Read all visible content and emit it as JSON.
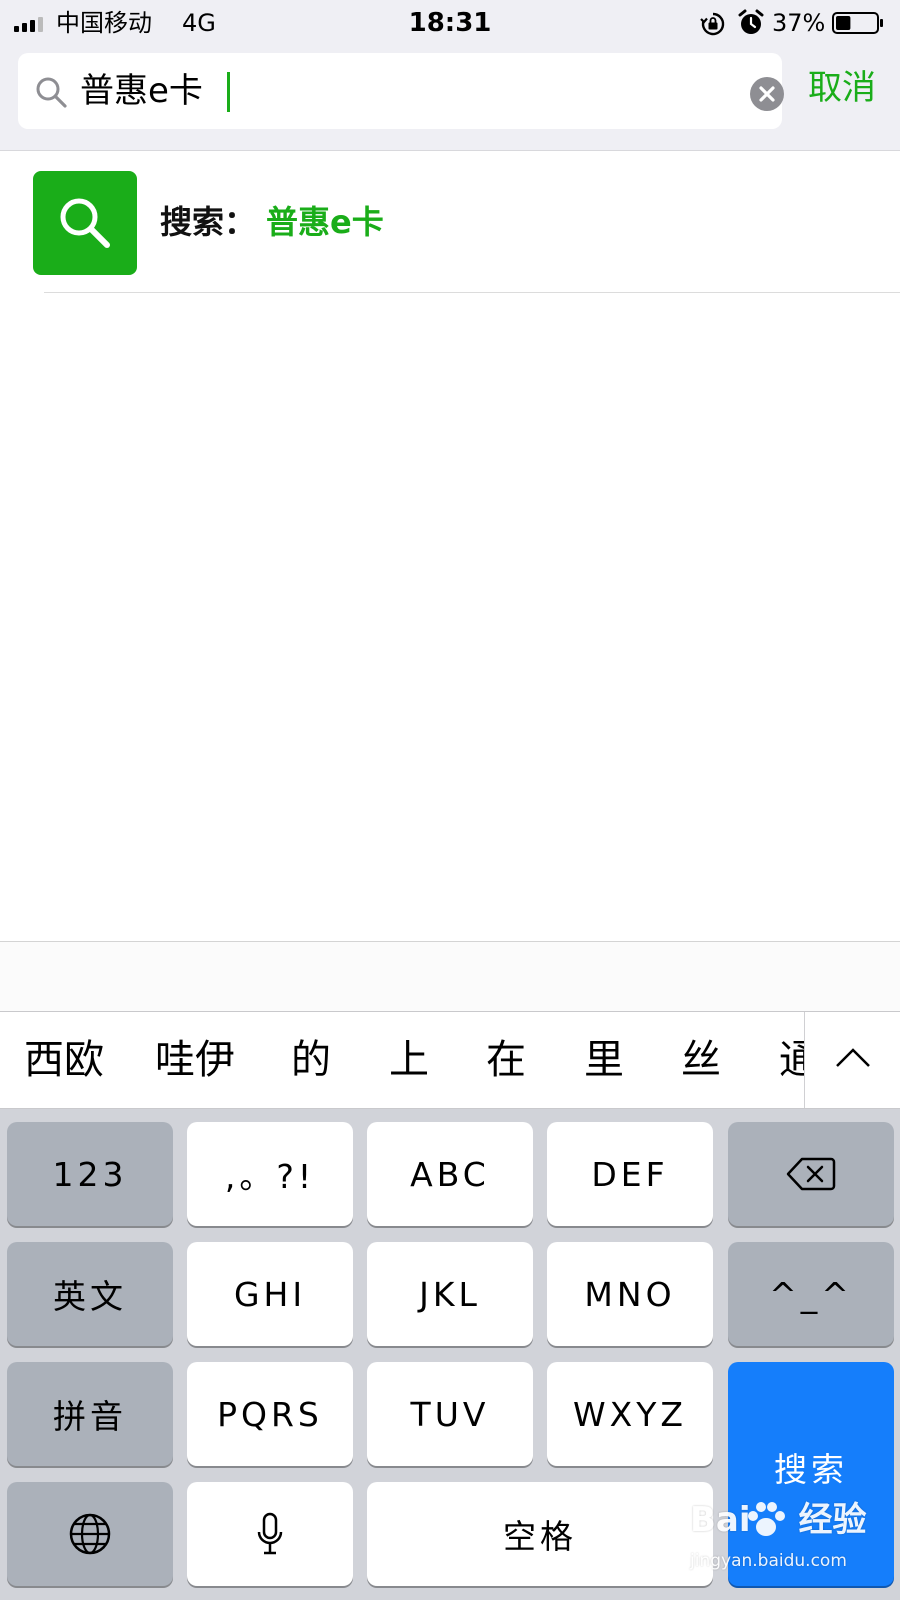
{
  "status_bar": {
    "carrier": "中国移动",
    "network": "4G",
    "time": "18:31",
    "battery_percent": "37%",
    "battery_level": 0.37,
    "signal_bars": 3,
    "icons": [
      "signal-icon",
      "rotation-lock-icon",
      "alarm-icon",
      "battery-icon"
    ]
  },
  "search": {
    "query": "普惠e卡",
    "cancel_label": "取消",
    "icons": [
      "search-icon",
      "clear-icon"
    ]
  },
  "suggestion": {
    "prefix": "搜索：",
    "query": "普惠e卡",
    "icon": "search-icon",
    "accent_color": "#1aad19"
  },
  "candidates": {
    "items": [
      "西欧",
      "哇伊",
      "的",
      "上",
      "在",
      "里",
      "丝",
      "通"
    ],
    "expand_icon": "chevron-up-icon"
  },
  "keyboard": {
    "rows": [
      [
        "123",
        ",。?!",
        "ABC",
        "DEF",
        "⌫"
      ],
      [
        "英文",
        "GHI",
        "JKL",
        "MNO",
        "^_^"
      ],
      [
        "拼音",
        "PQRS",
        "TUV",
        "WXYZ"
      ],
      [
        "globe",
        "mic",
        "空格"
      ]
    ],
    "labels": {
      "num": "123",
      "punct": ",。?!",
      "abc": "ABC",
      "def": "DEF",
      "english": "英文",
      "ghi": "GHI",
      "jkl": "JKL",
      "mno": "MNO",
      "emoticon": "^_^",
      "pinyin": "拼音",
      "pqrs": "PQRS",
      "tuv": "TUV",
      "wxyz": "WXYZ",
      "space": "空格",
      "search": "搜索"
    },
    "icons": [
      "backspace-icon",
      "globe-icon",
      "microphone-icon"
    ],
    "search_key_color": "#157efb"
  },
  "watermark": {
    "logo": "Bai 经验",
    "url": "jingyan.baidu.com"
  }
}
